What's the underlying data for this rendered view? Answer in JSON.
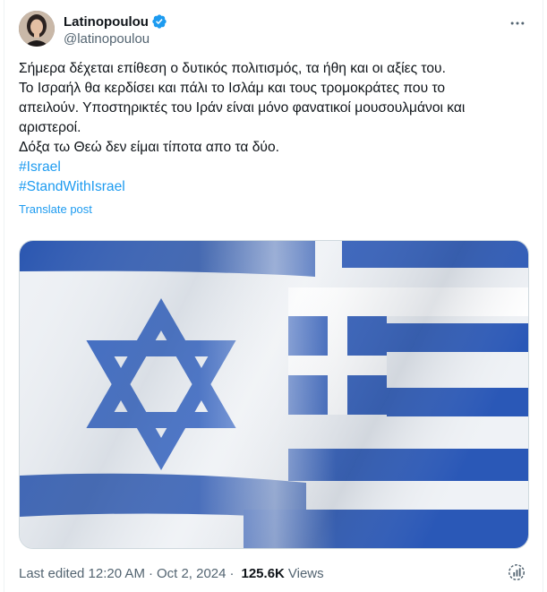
{
  "author": {
    "display_name": "Latinopoulou",
    "handle": "@latinopoulou",
    "verified": true
  },
  "post": {
    "lines": [
      "Σήμερα δέχεται επίθεση ο δυτικός πολιτισμός, τα ήθη και οι αξίες του.",
      "Το Ισραήλ θα κερδίσει και πάλι το Ισλάμ και τους τρομοκράτες που το",
      "απειλούν. Υποστηρικτές του Ιράν είναι μόνο φανατικοί μουσουλμάνοι και",
      "αριστεροί.",
      "Δόξα τω Θεώ δεν είμαι τίποτα απο τα δύο."
    ],
    "hashtags": [
      "#Israel",
      "#StandWithIsrael"
    ],
    "translate_label": "Translate post"
  },
  "meta": {
    "edited_label": "Last edited 12:20 AM",
    "date": "Oct 2, 2024",
    "views_count": "125.6K",
    "views_label": "Views"
  },
  "colors": {
    "link": "#1d9bf0",
    "verified_badge": "#1d9bf0",
    "flag_blue": "#1f4fb3"
  },
  "icons": {
    "more": "more-horizontal-icon",
    "verified": "verified-badge-icon",
    "analytics": "analytics-icon"
  }
}
